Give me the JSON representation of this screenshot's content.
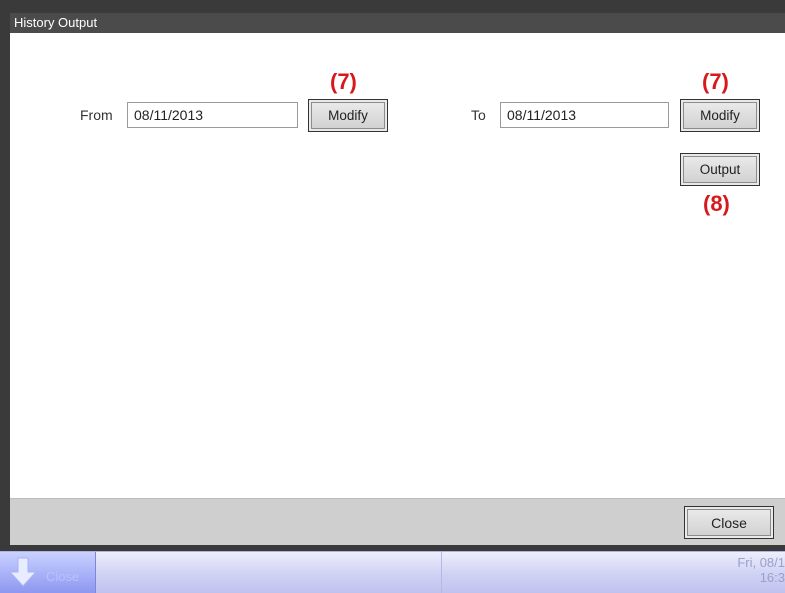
{
  "window": {
    "title": "History Output",
    "close_label": "Close"
  },
  "from": {
    "label": "From",
    "value": "08/11/2013",
    "modify_label": "Modify"
  },
  "to": {
    "label": "To",
    "value": "08/11/2013",
    "modify_label": "Modify"
  },
  "output": {
    "label": "Output"
  },
  "annotations": {
    "from_modify": "(7)",
    "to_modify": "(7)",
    "output": "(8)"
  },
  "taskbar": {
    "back_label": "Close",
    "date_line1": "Fri, 08/1",
    "date_line2": "16:3"
  },
  "colors": {
    "annotation": "#d7191c",
    "title_bar": "#4b4b4b",
    "taskbar": "#c8cbf2"
  }
}
